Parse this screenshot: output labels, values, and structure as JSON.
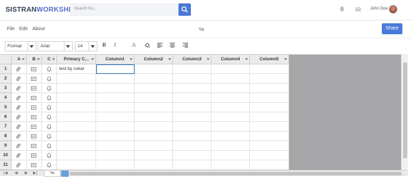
{
  "brand": {
    "part1": "SISTRAN",
    "part2": "WORKSHEET"
  },
  "search": {
    "placeholder": "Search for..."
  },
  "user": {
    "name": "John Doe"
  },
  "menu": {
    "file": "File",
    "edit": "Edit",
    "about": "About"
  },
  "document": {
    "title": "Ya"
  },
  "share_label": "Share",
  "toolbar": {
    "format": "Format",
    "font": "Arial",
    "size": "14",
    "bold": "B",
    "italic": "I",
    "text_color": "A"
  },
  "grid": {
    "headers": [
      "A",
      "B",
      "C",
      "Primary C...",
      "Column1",
      "Column2",
      "Column3",
      "Column4",
      "Column5"
    ],
    "rows": [
      "1",
      "2",
      "3",
      "4",
      "5",
      "6",
      "7",
      "8",
      "9",
      "10",
      "11"
    ],
    "cell_1_primary": "test by oskar"
  },
  "sheets": [
    {
      "name": "Ya"
    }
  ],
  "colors": {
    "accent": "#4a78d6",
    "brand_dark": "#2f3b52",
    "brand_light": "#5b6bc9"
  }
}
